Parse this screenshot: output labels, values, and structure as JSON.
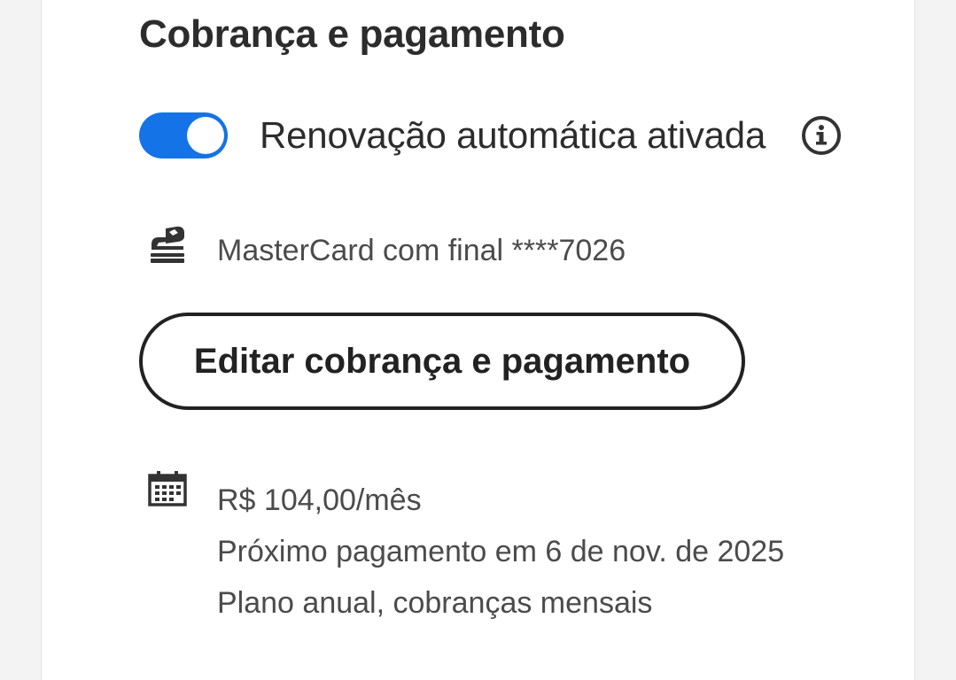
{
  "section": {
    "title": "Cobrança e pagamento"
  },
  "auto_renew": {
    "label": "Renovação automática ativada",
    "enabled": true,
    "toggle_color": "#1473e6"
  },
  "payment_method": {
    "icon": "credit-card-hand-icon",
    "text": "MasterCard com final ****7026"
  },
  "actions": {
    "edit_label": "Editar cobrança e pagamento"
  },
  "billing": {
    "icon": "calendar-icon",
    "price": "R$ 104,00/mês",
    "next_payment": "Próximo pagamento em 6 de nov. de 2025",
    "plan": "Plano anual, cobranças mensais"
  }
}
